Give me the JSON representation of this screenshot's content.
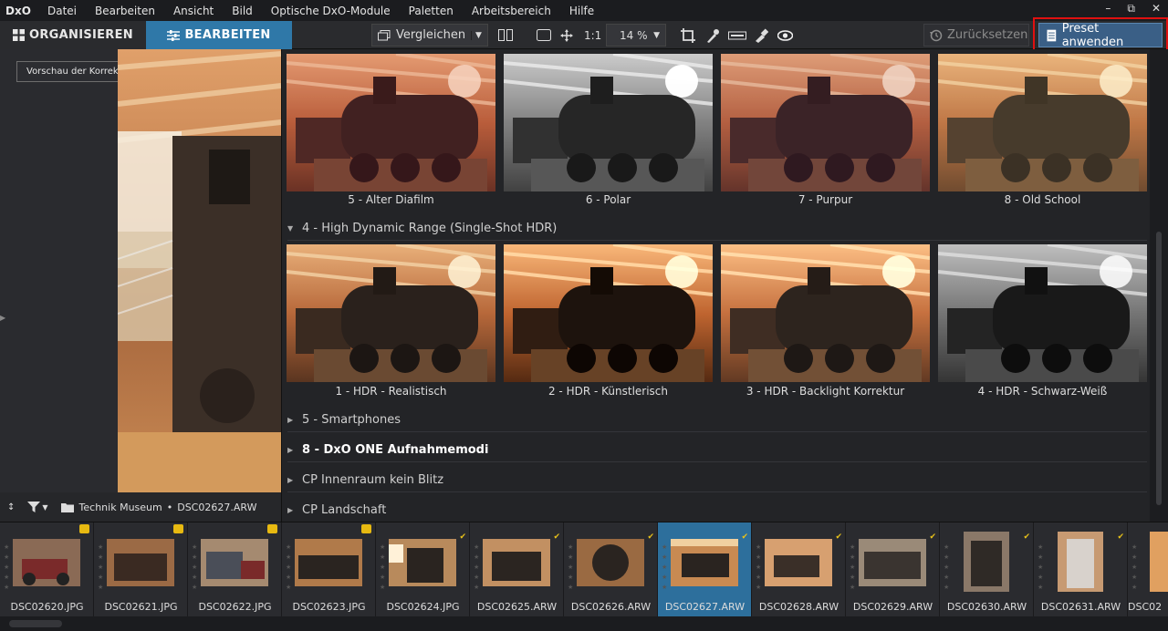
{
  "app": {
    "logo": "DxO",
    "menu": [
      "Datei",
      "Bearbeiten",
      "Ansicht",
      "Bild",
      "Optische DxO-Module",
      "Paletten",
      "Arbeitsbereich",
      "Hilfe"
    ],
    "window_controls": [
      "–",
      "⧉",
      "✕"
    ]
  },
  "toolbar": {
    "tab_organize": "ORGANISIEREN",
    "tab_edit": "BEARBEITEN",
    "compare_label": "Vergleichen",
    "one_to_one": "1:1",
    "zoom": "14 %",
    "reset_label": "Zurücksetzen",
    "preset_apply_label": "Preset anwenden"
  },
  "tooltip": "Vorschau der Korrekturen",
  "preset_panel": {
    "row1": [
      "5 - Alter Diafilm",
      "6 - Polar",
      "7 - Purpur",
      "8 - Old School"
    ],
    "group_hdr": "4 - High Dynamic Range (Single-Shot HDR)",
    "row2": [
      "1 - HDR - Realistisch",
      "2 - HDR - Künstlerisch",
      "3 - HDR - Backlight Korrektur",
      "4 - HDR - Schwarz-Weiß"
    ],
    "groups": [
      "5 - Smartphones",
      "8 - DxO ONE Aufnahmemodi",
      "CP Innenraum kein Blitz",
      "CP Landschaft"
    ]
  },
  "status": {
    "sort_icon": "sort-az-icon",
    "folder": "Technik Museum",
    "separator": "•",
    "file": "DSC02627.ARW"
  },
  "filmstrip": [
    "DSC02620.JPG",
    "DSC02621.JPG",
    "DSC02622.JPG",
    "DSC02623.JPG",
    "DSC02624.JPG",
    "DSC02625.ARW",
    "DSC02626.ARW",
    "DSC02627.ARW",
    "DSC02628.ARW",
    "DSC02629.ARW",
    "DSC02630.ARW",
    "DSC02631.ARW",
    "DSC02"
  ],
  "colors": {
    "accent": "#2f78a8",
    "highlight_border": "#e01010",
    "preset_button": "#3a5f86"
  }
}
